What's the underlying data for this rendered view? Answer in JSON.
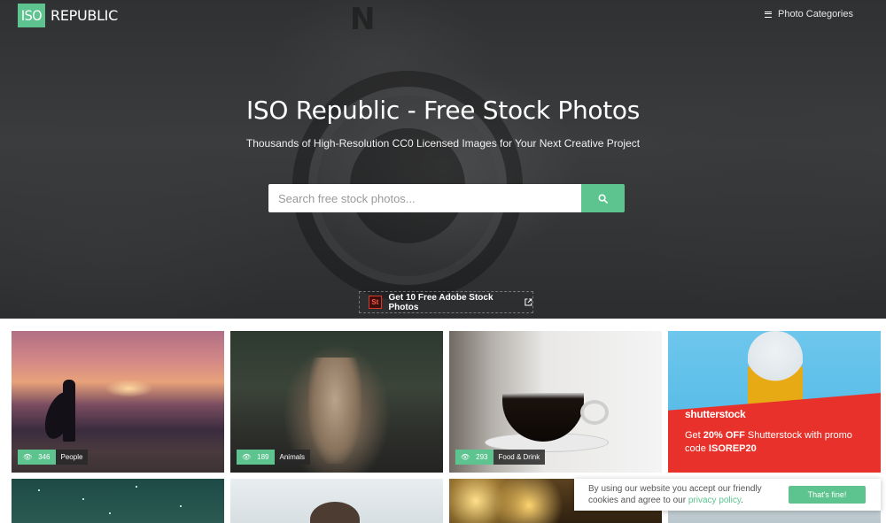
{
  "brand": {
    "logo_box": "ISO",
    "logo_word": "REPUBLIC",
    "accent_color": "#5ec48f"
  },
  "nav": {
    "categories_label": "Photo Categories",
    "menu_icon": "hamburger-icon"
  },
  "hero": {
    "title": "ISO Republic - Free Stock Photos",
    "subtitle": "Thousands of High-Resolution CC0 Licensed Images for Your Next Creative Project",
    "search_placeholder": "Search free stock photos...",
    "search_icon": "search-icon",
    "adobe_badge": "St",
    "adobe_link": "Get 10 Free Adobe Stock Photos"
  },
  "photos": [
    {
      "count": "346",
      "category": "People"
    },
    {
      "count": "189",
      "category": "Animals"
    },
    {
      "count": "293",
      "category": "Food & Drink"
    }
  ],
  "ad": {
    "brand": "shutterstock",
    "line_prefix": "Get ",
    "discount": "20% OFF",
    "line_mid": " Shutterstock with promo code ",
    "code": "ISOREP20",
    "ad_color": "#e8312a"
  },
  "cookie": {
    "text_before": "By using our website you accept our friendly cookies and agree to our ",
    "link": "privacy policy",
    "text_after": ".",
    "button": "That's fine!"
  }
}
